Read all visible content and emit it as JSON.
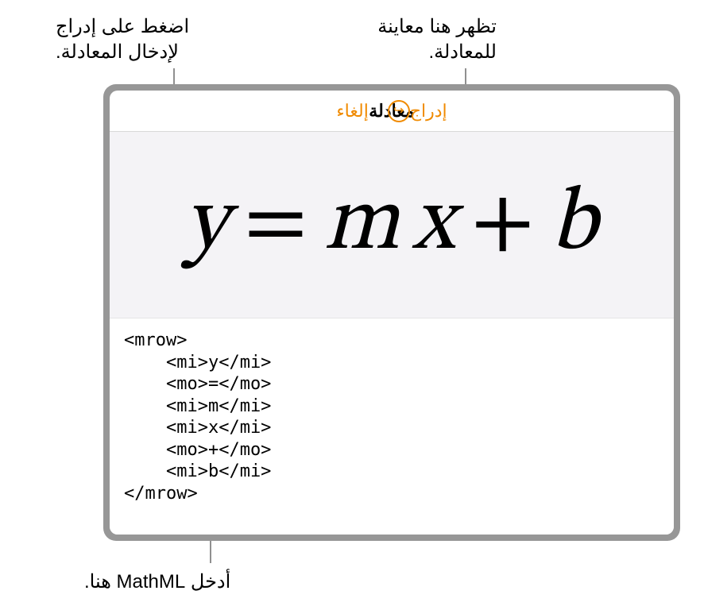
{
  "callouts": {
    "insert": "اضغط على إدراج\nلإدخال المعادلة.",
    "preview": "تظهر هنا معاينة\nللمعادلة.",
    "enter": "أدخل MathML هنا."
  },
  "header": {
    "insert_label": "إدراج",
    "cancel_label": "إلغاء",
    "title": "معادلة",
    "undo_glyph": "↪"
  },
  "equation": {
    "var_y": "y",
    "eq": "=",
    "var_m": "m",
    "var_x": "x",
    "plus": "+",
    "var_b": "b"
  },
  "code": "<mrow>\n    <mi>y</mi>\n    <mo>=</mo>\n    <mi>m</mi>\n    <mi>x</mi>\n    <mo>+</mo>\n    <mi>b</mi>\n</mrow>"
}
